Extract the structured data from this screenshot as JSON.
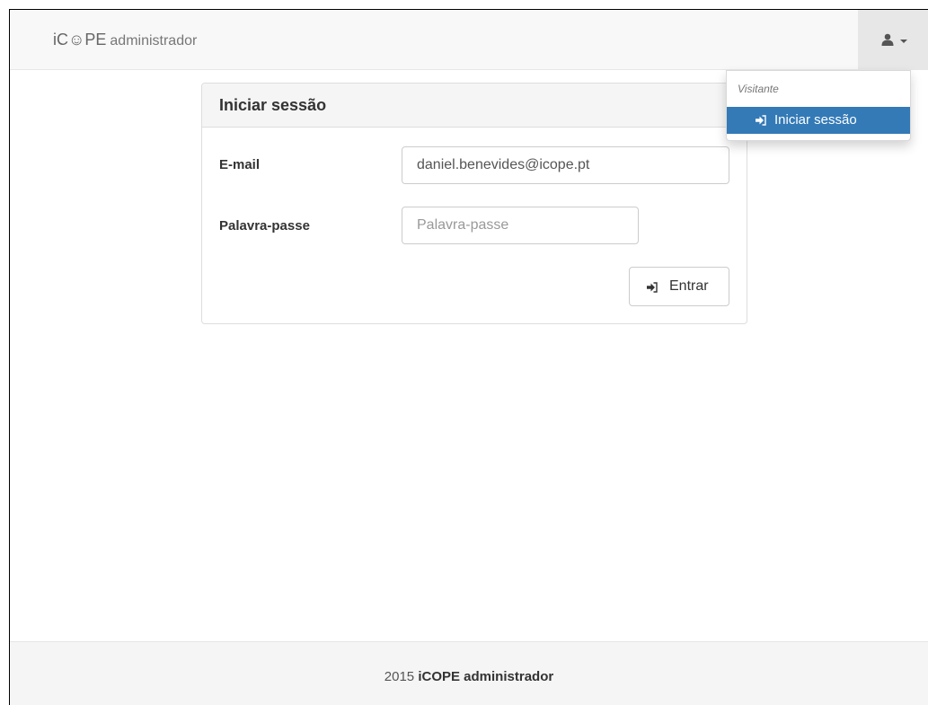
{
  "navbar": {
    "brand_logo": "iC☺PE",
    "brand_sub": "administrador",
    "user_icon": "user-icon",
    "caret_icon": "caret-down-icon"
  },
  "dropdown": {
    "header": "Visitante",
    "item_label": "Iniciar sessão",
    "item_icon": "sign-in-icon"
  },
  "panel": {
    "title": "Iniciar sessão",
    "email_label": "E-mail",
    "email_value": "daniel.benevides@icope.pt",
    "password_label": "Palavra-passe",
    "password_placeholder": "Palavra-passe",
    "submit_label": "Entrar",
    "submit_icon": "sign-in-icon"
  },
  "footer": {
    "year": "2015",
    "brand": "iCOPE administrador"
  },
  "colors": {
    "primary": "#337ab7",
    "navbar_bg": "#f8f8f8",
    "footer_bg": "#f5f5f5"
  }
}
